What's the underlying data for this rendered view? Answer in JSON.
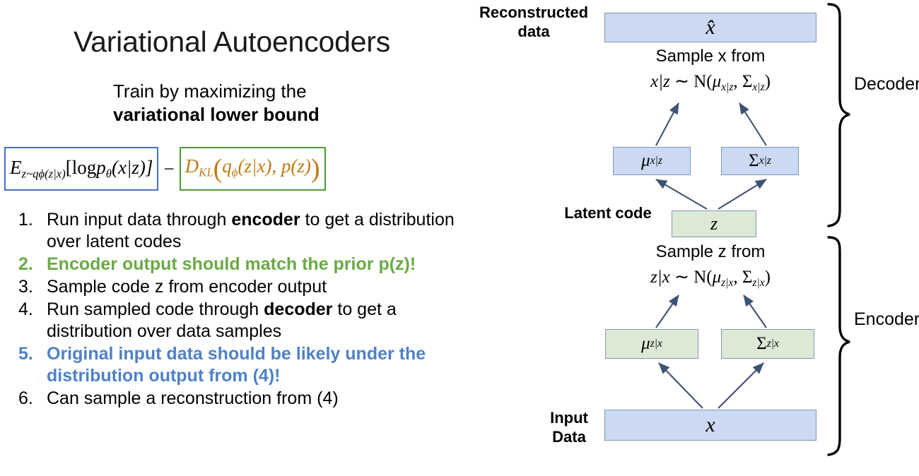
{
  "slide": {
    "title": "Variational Autoencoders",
    "subtitle_line1": "Train by maximizing the",
    "subtitle_line2": "variational lower bound"
  },
  "equation": {
    "reconstruction_term": "E_{z~q_phi(z|x)}[log p_theta(x|z)]",
    "operator": "−",
    "kl_term": "D_KL( q_phi(z|x), p(z) )",
    "reconstruction_box_color": "#4472c4",
    "kl_box_color": "#4e9a35",
    "parts": {
      "E": "E",
      "E_sub_z": "z~q",
      "E_sub_phi": "ϕ",
      "E_sub_tail": "(z|x)",
      "bracket_open": "[log",
      "p": "p",
      "p_sub": "θ",
      "p_args": "(x|z)]",
      "D": "D",
      "D_sub": "KL",
      "paren_open": "(",
      "q": "q",
      "q_sub": "ϕ",
      "q_args": "(z|x), p(z)",
      "paren_close": ")"
    }
  },
  "steps": [
    {
      "num": "1.",
      "style": "black",
      "segments": [
        {
          "text": "Run input data through ",
          "bold": false
        },
        {
          "text": "encoder",
          "bold": true
        },
        {
          "text": " to get a distribution over latent codes",
          "bold": false
        }
      ]
    },
    {
      "num": "2.",
      "style": "green",
      "segments": [
        {
          "text": "Encoder output should match the prior p(z)!",
          "bold": true
        }
      ]
    },
    {
      "num": "3.",
      "style": "black",
      "segments": [
        {
          "text": "Sample code z from encoder output",
          "bold": false
        }
      ]
    },
    {
      "num": "4.",
      "style": "black",
      "segments": [
        {
          "text": "Run sampled code through ",
          "bold": false
        },
        {
          "text": "decoder",
          "bold": true
        },
        {
          "text": " to get a distribution over data samples",
          "bold": false
        }
      ]
    },
    {
      "num": "5.",
      "style": "blue",
      "segments": [
        {
          "text": "Original input data should be likely under the distribution output from (4)!",
          "bold": true
        }
      ]
    },
    {
      "num": "6.",
      "style": "black",
      "segments": [
        {
          "text": "Can sample a reconstruction from (4)",
          "bold": false
        }
      ]
    }
  ],
  "step_colors": {
    "black": "#000000",
    "green": "#6aaa46",
    "blue": "#4f81c7"
  },
  "diagram": {
    "labels": {
      "reconstructed_data": "Reconstructed data",
      "latent_code": "Latent code",
      "input_data": "Input Data",
      "decoder": "Decoder",
      "encoder": "Encoder"
    },
    "captions": {
      "sample_x": "Sample x from",
      "sample_z": "Sample z from"
    },
    "formulas": {
      "decoder": {
        "lhs": "x|z",
        "tilde": "∼",
        "normal": "Ν",
        "mu": "μ",
        "mu_sub": "x|z",
        "sigma": "Σ",
        "sigma_sub": "x|z"
      },
      "encoder": {
        "lhs": "z|x",
        "tilde": "∼",
        "normal": "Ν",
        "mu": "μ",
        "mu_sub": "z|x",
        "sigma": "Σ",
        "sigma_sub": "z|x"
      }
    },
    "nodes": {
      "xhat": {
        "symbol": "x̂",
        "color": "blue"
      },
      "mu_xz": {
        "symbol": "μ",
        "sub": "x|z",
        "color": "blue"
      },
      "sigma_xz": {
        "symbol": "Σ",
        "sub": "x|z",
        "color": "blue"
      },
      "z": {
        "symbol": "z",
        "color": "green"
      },
      "mu_zx": {
        "symbol": "μ",
        "sub": "z|x",
        "color": "green"
      },
      "sigma_zx": {
        "symbol": "Σ",
        "sub": "z|x",
        "color": "green"
      },
      "x": {
        "symbol": "x",
        "color": "blue"
      }
    },
    "colors": {
      "box_blue_fill": "#cbd9f3",
      "box_green_fill": "#dce9d5",
      "box_border": "#8096b4",
      "arrow": "#3d5373"
    }
  }
}
